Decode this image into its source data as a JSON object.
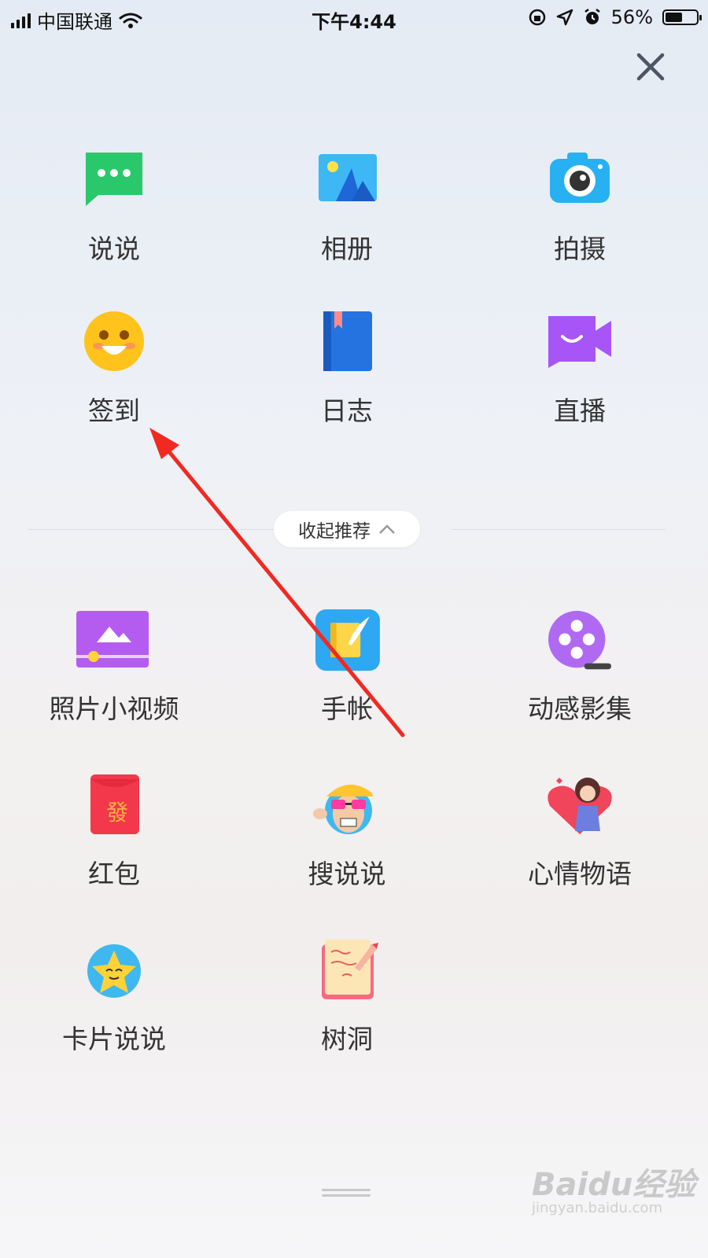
{
  "statusbar": {
    "carrier": "中国联通",
    "time": "下午4:44",
    "battery_text": "56%",
    "battery_level": 0.56
  },
  "header": {
    "close_icon": "close-x"
  },
  "actions": [
    {
      "label": "说说",
      "icon": "chat-bubble-icon"
    },
    {
      "label": "相册",
      "icon": "album-icon"
    },
    {
      "label": "拍摄",
      "icon": "camera-icon"
    },
    {
      "label": "签到",
      "icon": "smiley-icon"
    },
    {
      "label": "日志",
      "icon": "book-icon"
    },
    {
      "label": "直播",
      "icon": "live-camera-icon"
    }
  ],
  "divider": {
    "label": "收起推荐"
  },
  "recommended": [
    {
      "label": "照片小视频",
      "icon": "photo-video-icon"
    },
    {
      "label": "手帐",
      "icon": "notebook-icon"
    },
    {
      "label": "动感影集",
      "icon": "film-reel-icon"
    },
    {
      "label": "红包",
      "icon": "red-envelope-icon"
    },
    {
      "label": "搜说说",
      "icon": "sunglasses-character-icon"
    },
    {
      "label": "心情物语",
      "icon": "girl-heart-icon"
    },
    {
      "label": "卡片说说",
      "icon": "star-character-icon"
    },
    {
      "label": "树洞",
      "icon": "letter-pen-icon"
    }
  ],
  "watermark": {
    "brand": "Baidu经验",
    "url": "jingyan.baidu.com"
  },
  "colors": {
    "annotation_arrow": "#f02a22"
  }
}
